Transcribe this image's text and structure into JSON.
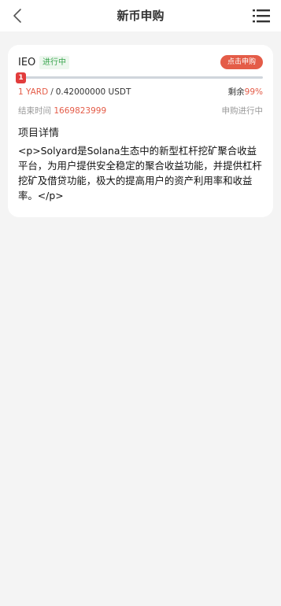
{
  "header": {
    "title": "新币申购",
    "back_icon": "chevron-left-icon",
    "menu_icon": "list-menu-icon"
  },
  "card": {
    "type_label": "IEO",
    "status_badge": "进行中",
    "subscribe_button": "点击申购",
    "progress": {
      "marker_label": "1",
      "fill_fraction": 0.01
    },
    "amount": "1 YARD",
    "separator": "/",
    "price": "0.42000000 USDT",
    "remain_label": "剩余",
    "remain_value": "99%",
    "end_time_label": "结束时间",
    "end_time_value": "1669823999",
    "time_status": "申购进行中",
    "detail_title": "项目详情",
    "detail_body": "<p>Solyard是Solana生态中的新型杠杆挖矿聚合收益平台，为用户提供安全稳定的聚合收益功能，并提供杠杆挖矿及借贷功能，极大的提高用户的资产利用率和收益率。</p>"
  },
  "colors": {
    "accent_red": "#e45c48",
    "progress_red": "#e23c3c",
    "status_green": "#3aa64f",
    "background": "#f4f4f4"
  }
}
